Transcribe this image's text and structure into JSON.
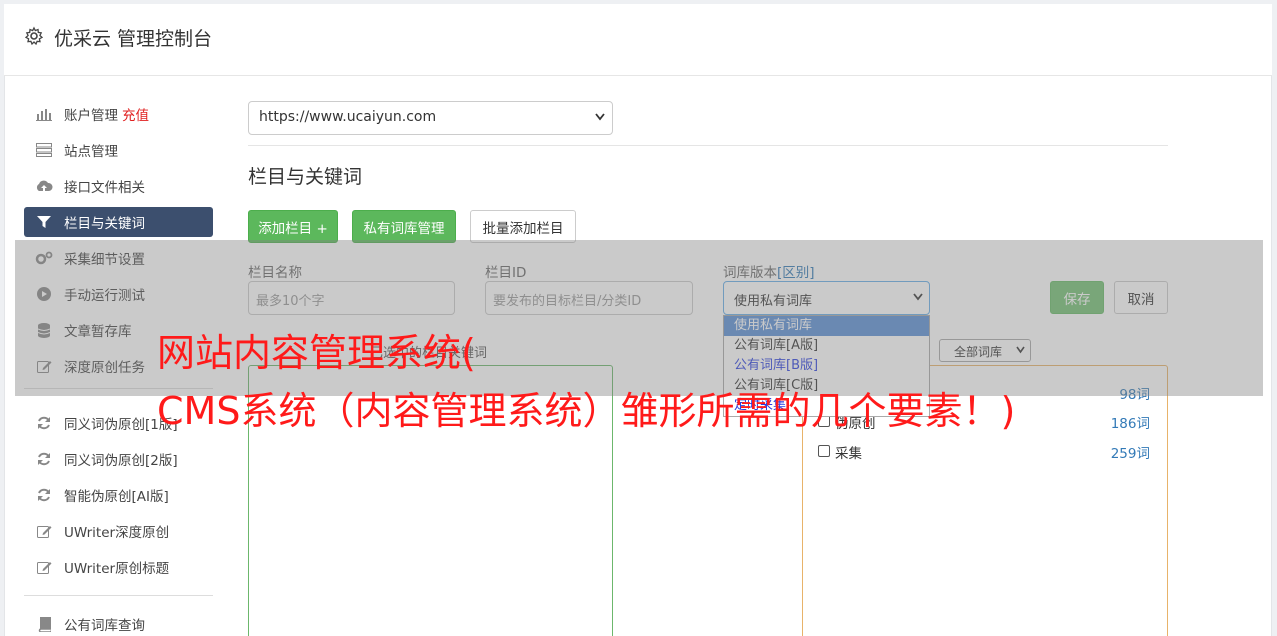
{
  "header": {
    "title": "优采云 管理控制台"
  },
  "sidebar": {
    "items": [
      {
        "label": "账户管理",
        "extra": "充值",
        "icon": "bar-chart-icon"
      },
      {
        "label": "站点管理",
        "icon": "server-icon"
      },
      {
        "label": "接口文件相关",
        "icon": "cloud-upload-icon"
      },
      {
        "label": "栏目与关键词",
        "icon": "filter-icon"
      },
      {
        "label": "采集细节设置",
        "icon": "cogs-icon"
      },
      {
        "label": "手动运行测试",
        "icon": "play-circle-icon"
      },
      {
        "label": "文章暂存库",
        "icon": "database-icon"
      },
      {
        "label": "深度原创任务",
        "icon": "edit-icon"
      },
      {
        "label": "同义词伪原创[1版]",
        "icon": "refresh-icon"
      },
      {
        "label": "同义词伪原创[2版]",
        "icon": "refresh-icon"
      },
      {
        "label": "智能伪原创[AI版]",
        "icon": "refresh-icon"
      },
      {
        "label": "UWriter深度原创",
        "icon": "edit-icon"
      },
      {
        "label": "UWriter原创标题",
        "icon": "edit-icon"
      },
      {
        "label": "公有词库查询",
        "icon": "book-icon"
      }
    ]
  },
  "main": {
    "site_select": {
      "value": "https://www.ucaiyun.com"
    },
    "section_title": "栏目与关键词",
    "buttons": {
      "add_column": "添加栏目 +",
      "private_lib": "私有词库管理",
      "batch_add": "批量添加栏目"
    },
    "form": {
      "name_label": "栏目名称",
      "name_placeholder": "最多10个字",
      "id_label": "栏目ID",
      "id_placeholder": "要发布的目标栏目/分类ID",
      "lib_label": "词库版本",
      "lib_label_link": "[区别]",
      "lib_value": "使用私有词库",
      "save": "保存",
      "cancel": "取消"
    },
    "dropdown_options": [
      "使用私有词库",
      "公有词库[A版]",
      "公有词库[B版]",
      "公有词库[C版]",
      "定时采集"
    ],
    "hint_text": "已选中的栏目关键词",
    "lib_filter": "全部词库",
    "library_rows": [
      {
        "name": "",
        "count": "98词"
      },
      {
        "name": "伪原创",
        "count": "186词"
      },
      {
        "name": "采集",
        "count": "259词"
      }
    ]
  },
  "overlay": {
    "title_line1": "网站内容管理系统(",
    "title_line2": "CMS系统（内容管理系统）雏形所需的几个要素！)"
  }
}
